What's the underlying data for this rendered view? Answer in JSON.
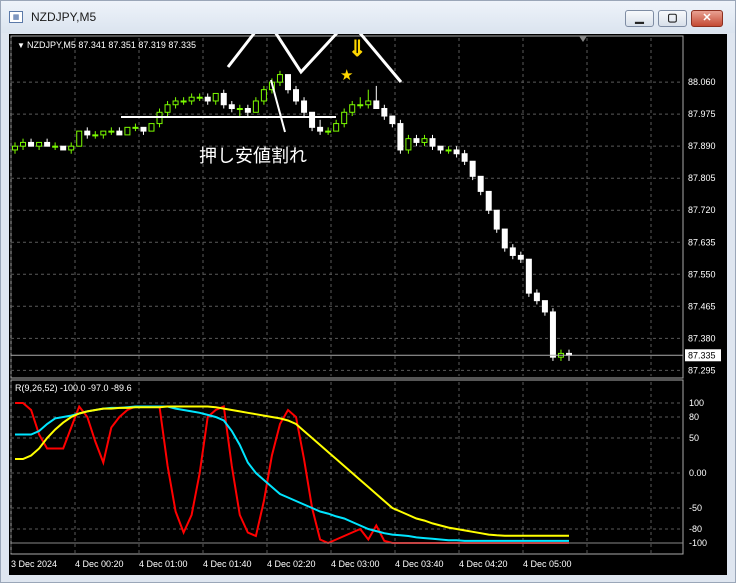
{
  "window": {
    "title": "NZDJPY,M5",
    "icon": "chart-window-icon"
  },
  "chart_data": [
    {
      "type": "candlestick",
      "header": "NZDJPY,M5  87.341 87.351 87.319 87.335",
      "current_price": "87.335",
      "y_ticks": [
        "88.060",
        "87.975",
        "87.890",
        "87.805",
        "87.720",
        "87.635",
        "87.550",
        "87.465",
        "87.380",
        "87.295"
      ],
      "ylim": [
        87.28,
        88.14
      ],
      "bull_color": "#7CFC00",
      "bear_color": "#ffffff",
      "candles": [
        [
          87.88,
          87.9,
          87.87,
          87.89
        ],
        [
          87.89,
          87.91,
          87.88,
          87.9
        ],
        [
          87.9,
          87.91,
          87.89,
          87.89
        ],
        [
          87.89,
          87.9,
          87.88,
          87.9
        ],
        [
          87.9,
          87.91,
          87.89,
          87.89
        ],
        [
          87.89,
          87.9,
          87.88,
          87.89
        ],
        [
          87.89,
          87.89,
          87.88,
          87.88
        ],
        [
          87.88,
          87.9,
          87.87,
          87.89
        ],
        [
          87.89,
          87.93,
          87.89,
          87.93
        ],
        [
          87.93,
          87.94,
          87.91,
          87.92
        ],
        [
          87.92,
          87.93,
          87.91,
          87.92
        ],
        [
          87.92,
          87.93,
          87.91,
          87.93
        ],
        [
          87.93,
          87.94,
          87.92,
          87.93
        ],
        [
          87.93,
          87.94,
          87.92,
          87.92
        ],
        [
          87.92,
          87.94,
          87.92,
          87.94
        ],
        [
          87.94,
          87.95,
          87.93,
          87.94
        ],
        [
          87.94,
          87.94,
          87.92,
          87.93
        ],
        [
          87.93,
          87.95,
          87.93,
          87.95
        ],
        [
          87.95,
          87.99,
          87.94,
          87.98
        ],
        [
          87.98,
          88.01,
          87.97,
          88.0
        ],
        [
          88.0,
          88.02,
          87.99,
          88.01
        ],
        [
          88.01,
          88.02,
          88.0,
          88.01
        ],
        [
          88.01,
          88.03,
          88.0,
          88.02
        ],
        [
          88.02,
          88.03,
          88.01,
          88.02
        ],
        [
          88.02,
          88.03,
          88.0,
          88.01
        ],
        [
          88.01,
          88.03,
          88.0,
          88.03
        ],
        [
          88.03,
          88.04,
          87.99,
          88.0
        ],
        [
          88.0,
          88.01,
          87.98,
          87.99
        ],
        [
          87.99,
          88.0,
          87.97,
          87.99
        ],
        [
          87.99,
          88.0,
          87.97,
          87.98
        ],
        [
          87.98,
          88.02,
          87.98,
          88.01
        ],
        [
          88.01,
          88.05,
          88.0,
          88.04
        ],
        [
          88.04,
          88.07,
          88.03,
          88.06
        ],
        [
          88.06,
          88.09,
          88.05,
          88.08
        ],
        [
          88.08,
          88.08,
          88.03,
          88.04
        ],
        [
          88.04,
          88.05,
          88.0,
          88.01
        ],
        [
          88.01,
          88.02,
          87.97,
          87.98
        ],
        [
          87.98,
          87.98,
          87.93,
          87.94
        ],
        [
          87.94,
          87.96,
          87.92,
          87.93
        ],
        [
          87.93,
          87.94,
          87.92,
          87.93
        ],
        [
          87.93,
          87.96,
          87.93,
          87.95
        ],
        [
          87.95,
          87.99,
          87.94,
          87.98
        ],
        [
          87.98,
          88.01,
          87.97,
          88.0
        ],
        [
          88.0,
          88.02,
          87.99,
          88.0
        ],
        [
          88.0,
          88.04,
          87.99,
          88.01
        ],
        [
          88.01,
          88.05,
          88.0,
          87.99
        ],
        [
          87.99,
          88.0,
          87.96,
          87.97
        ],
        [
          87.97,
          87.97,
          87.94,
          87.95
        ],
        [
          87.95,
          87.96,
          87.87,
          87.88
        ],
        [
          87.88,
          87.92,
          87.87,
          87.91
        ],
        [
          87.91,
          87.92,
          87.89,
          87.9
        ],
        [
          87.9,
          87.92,
          87.89,
          87.91
        ],
        [
          87.91,
          87.92,
          87.88,
          87.89
        ],
        [
          87.89,
          87.89,
          87.87,
          87.88
        ],
        [
          87.88,
          87.89,
          87.87,
          87.88
        ],
        [
          87.88,
          87.89,
          87.86,
          87.87
        ],
        [
          87.87,
          87.88,
          87.84,
          87.85
        ],
        [
          87.85,
          87.85,
          87.8,
          87.81
        ],
        [
          87.81,
          87.81,
          87.76,
          87.77
        ],
        [
          87.77,
          87.77,
          87.71,
          87.72
        ],
        [
          87.72,
          87.72,
          87.66,
          87.67
        ],
        [
          87.67,
          87.67,
          87.61,
          87.62
        ],
        [
          87.62,
          87.63,
          87.59,
          87.6
        ],
        [
          87.6,
          87.61,
          87.58,
          87.59
        ],
        [
          87.59,
          87.59,
          87.49,
          87.5
        ],
        [
          87.5,
          87.51,
          87.47,
          87.48
        ],
        [
          87.48,
          87.48,
          87.44,
          87.45
        ],
        [
          87.45,
          87.46,
          87.32,
          87.33
        ],
        [
          87.33,
          87.35,
          87.32,
          87.34
        ],
        [
          87.34,
          87.35,
          87.32,
          87.335
        ]
      ],
      "annotations": {
        "support_label": "押し安値割れ",
        "marker": "star-arrow"
      }
    },
    {
      "type": "line",
      "header": "R(9,26,52) -100.0 -97.0 -89.6",
      "y_ticks": [
        "100",
        "80",
        "50",
        "0.00",
        "-50",
        "-80",
        "-100"
      ],
      "ylim": [
        -110,
        110
      ],
      "x_ticks": [
        "3 Dec 2024",
        "4 Dec 00:20",
        "4 Dec 01:00",
        "4 Dec 01:40",
        "4 Dec 02:20",
        "4 Dec 03:00",
        "4 Dec 03:40",
        "4 Dec 04:20",
        "4 Dec 05:00"
      ],
      "series": [
        {
          "color": "#ff0000",
          "values": [
            100,
            100,
            90,
            55,
            35,
            35,
            35,
            65,
            95,
            80,
            45,
            15,
            65,
            80,
            90,
            95,
            95,
            95,
            95,
            10,
            -55,
            -85,
            -60,
            0,
            80,
            90,
            95,
            10,
            -60,
            -85,
            -90,
            -40,
            25,
            70,
            90,
            80,
            20,
            -50,
            -95,
            -100,
            -95,
            -90,
            -85,
            -80,
            -95,
            -75,
            -97,
            -100,
            -100,
            -100,
            -100,
            -100,
            -100,
            -100,
            -100,
            -100,
            -100,
            -100,
            -100,
            -100,
            -100,
            -100,
            -100,
            -100,
            -100,
            -100,
            -100,
            -100,
            -100,
            -100
          ]
        },
        {
          "color": "#00e5ff",
          "values": [
            55,
            55,
            55,
            60,
            70,
            78,
            80,
            82,
            85,
            88,
            90,
            92,
            93,
            93,
            94,
            95,
            95,
            95,
            95,
            95,
            92,
            90,
            88,
            86,
            83,
            80,
            75,
            60,
            40,
            15,
            0,
            -10,
            -20,
            -30,
            -35,
            -40,
            -45,
            -50,
            -55,
            -58,
            -62,
            -65,
            -70,
            -75,
            -80,
            -83,
            -86,
            -88,
            -89,
            -90,
            -92,
            -93,
            -94,
            -95,
            -96,
            -96,
            -97,
            -97,
            -97,
            -97,
            -97,
            -97,
            -97,
            -97,
            -97,
            -97,
            -97,
            -97,
            -97,
            -97
          ]
        },
        {
          "color": "#ffff00",
          "values": [
            20,
            20,
            25,
            35,
            50,
            62,
            72,
            80,
            85,
            88,
            90,
            92,
            92,
            93,
            93,
            94,
            94,
            94,
            94,
            95,
            95,
            95,
            95,
            95,
            95,
            94,
            92,
            90,
            88,
            86,
            84,
            82,
            80,
            78,
            75,
            70,
            60,
            50,
            40,
            30,
            20,
            10,
            0,
            -10,
            -20,
            -30,
            -40,
            -50,
            -55,
            -60,
            -65,
            -68,
            -72,
            -75,
            -78,
            -80,
            -82,
            -84,
            -86,
            -88,
            -89,
            -89.6,
            -89.6,
            -89.6,
            -89.6,
            -89.6,
            -89.6,
            -89.6,
            -89.6,
            -89.6
          ]
        }
      ]
    }
  ]
}
